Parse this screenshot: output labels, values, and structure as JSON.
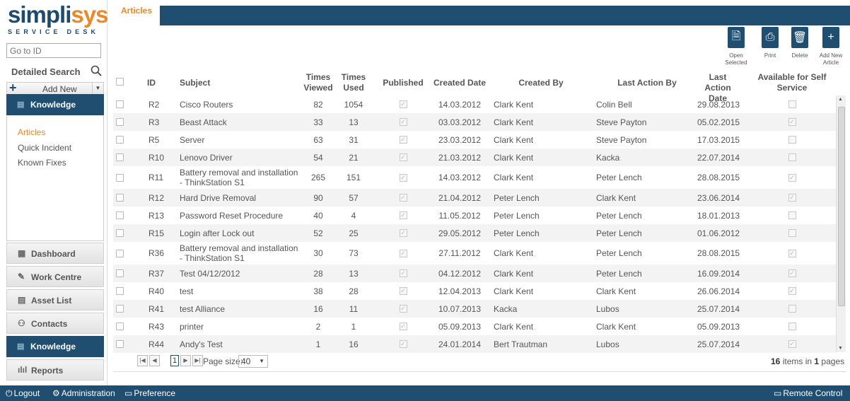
{
  "logo": {
    "main_a": "simpli",
    "main_b": "sys",
    "sub": "SERVICE DESK"
  },
  "sidebar": {
    "goto_placeholder": "Go to ID",
    "detailed_search": "Detailed Search",
    "add_new": "Add New",
    "knowledge_header": "Knowledge",
    "sub_items": [
      "Articles",
      "Quick Incident",
      "Known Fixes"
    ],
    "nav": [
      "Dashboard",
      "Work Centre",
      "Asset List",
      "Contacts",
      "Knowledge",
      "Reports"
    ]
  },
  "tab": {
    "label": "Articles"
  },
  "toolbar": {
    "open": "Open Selected",
    "print": "Print",
    "delete": "Delete",
    "add": "Add New Article"
  },
  "grid": {
    "columns": [
      "ID",
      "Subject",
      "Times Viewed",
      "Times Used",
      "Published",
      "Created Date",
      "Created By",
      "Last Action By",
      "Last Action Date",
      "Available for Self Service"
    ],
    "rows": [
      {
        "id": "R2",
        "subject": "Cisco Routers",
        "viewed": "82",
        "used": "1054",
        "created": "14.03.2012",
        "by": "Clark Kent",
        "last_by": "Colin Bell",
        "last_date": "29.08.2013",
        "self": false
      },
      {
        "id": "R3",
        "subject": "Beast Attack",
        "viewed": "33",
        "used": "13",
        "created": "03.03.2012",
        "by": "Clark Kent",
        "last_by": "Steve Payton",
        "last_date": "05.02.2015",
        "self": true
      },
      {
        "id": "R5",
        "subject": "Server",
        "viewed": "63",
        "used": "31",
        "created": "23.03.2012",
        "by": "Clark Kent",
        "last_by": "Steve Payton",
        "last_date": "17.03.2015",
        "self": false
      },
      {
        "id": "R10",
        "subject": "Lenovo Driver",
        "viewed": "54",
        "used": "21",
        "created": "21.03.2012",
        "by": "Clark Kent",
        "last_by": "Kacka",
        "last_date": "22.07.2014",
        "self": false
      },
      {
        "id": "R11",
        "subject": "Battery removal and installation - ThinkStation S1",
        "viewed": "265",
        "used": "151",
        "created": "14.03.2012",
        "by": "Clark Kent",
        "last_by": "Peter Lench",
        "last_date": "28.08.2015",
        "self": true
      },
      {
        "id": "R12",
        "subject": "Hard Drive Removal",
        "viewed": "90",
        "used": "57",
        "created": "21.04.2012",
        "by": "Peter Lench",
        "last_by": "Clark Kent",
        "last_date": "23.06.2014",
        "self": true
      },
      {
        "id": "R13",
        "subject": "Password Reset Procedure",
        "viewed": "40",
        "used": "4",
        "created": "11.05.2012",
        "by": "Peter Lench",
        "last_by": "Peter Lench",
        "last_date": "18.01.2013",
        "self": false
      },
      {
        "id": "R15",
        "subject": "Login after Lock out",
        "viewed": "52",
        "used": "25",
        "created": "29.05.2012",
        "by": "Peter Lench",
        "last_by": "Peter Lench",
        "last_date": "01.06.2012",
        "self": false
      },
      {
        "id": "R36",
        "subject": "Battery removal and installation - ThinkStation S1",
        "viewed": "30",
        "used": "73",
        "created": "27.11.2012",
        "by": "Clark Kent",
        "last_by": "Peter Lench",
        "last_date": "28.08.2015",
        "self": true
      },
      {
        "id": "R37",
        "subject": "Test 04/12/2012",
        "viewed": "28",
        "used": "13",
        "created": "04.12.2012",
        "by": "Clark Kent",
        "last_by": "Peter Lench",
        "last_date": "16.09.2014",
        "self": true
      },
      {
        "id": "R40",
        "subject": "test",
        "viewed": "38",
        "used": "28",
        "created": "12.04.2013",
        "by": "Clark Kent",
        "last_by": "Clark Kent",
        "last_date": "26.06.2014",
        "self": true
      },
      {
        "id": "R41",
        "subject": "test Alliance",
        "viewed": "16",
        "used": "11",
        "created": "10.07.2013",
        "by": "Kacka",
        "last_by": "Lubos",
        "last_date": "25.07.2014",
        "self": false
      },
      {
        "id": "R43",
        "subject": "printer",
        "viewed": "2",
        "used": "1",
        "created": "05.09.2013",
        "by": "Clark Kent",
        "last_by": "Clark Kent",
        "last_date": "05.09.2013",
        "self": false
      },
      {
        "id": "R44",
        "subject": "Andy's Test",
        "viewed": "1",
        "used": "16",
        "created": "24.01.2014",
        "by": "Bert Trautman",
        "last_by": "Lubos",
        "last_date": "25.07.2014",
        "self": true
      }
    ]
  },
  "pager": {
    "page": "1",
    "size_label": "Page size:",
    "size": "40",
    "items_count": "16",
    "items_mid": "items in",
    "pages_count": "1",
    "pages_word": "pages"
  },
  "footer": {
    "logout": "Logout",
    "admin": "Administration",
    "pref": "Preference",
    "remote": "Remote Control"
  },
  "colors": {
    "navy": "#1f4e71",
    "accent": "#e88a2b"
  }
}
